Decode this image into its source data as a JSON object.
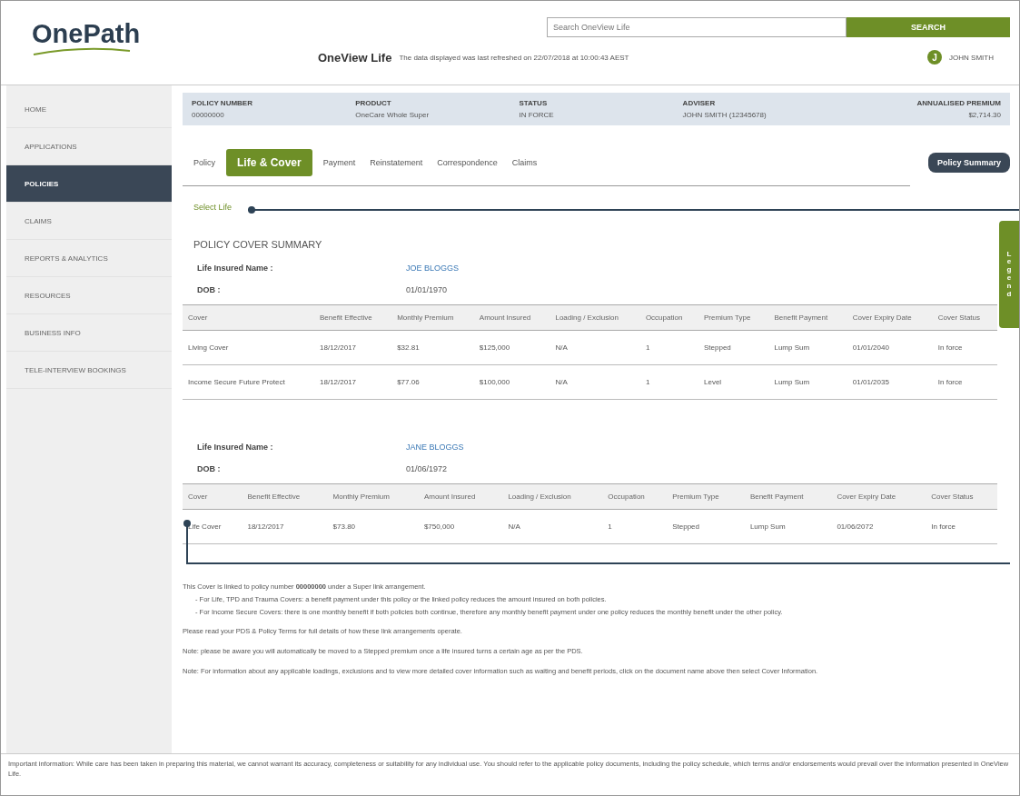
{
  "header": {
    "logo": "OnePath",
    "search": {
      "placeholder": "Search OneView Life"
    },
    "search_button": "SEARCH",
    "app_title": "OneView Life",
    "refresh_note": "The data displayed was last refreshed on 22/07/2018 at 10:00:43 AEST",
    "user": {
      "initial": "J",
      "name": "JOHN SMITH"
    }
  },
  "sidebar": {
    "items": [
      {
        "label": "HOME",
        "selected": false
      },
      {
        "label": "APPLICATIONS",
        "selected": false
      },
      {
        "label": "POLICIES",
        "selected": true
      },
      {
        "label": "CLAIMS",
        "selected": false
      },
      {
        "label": "REPORTS & ANALYTICS",
        "selected": false
      },
      {
        "label": "RESOURCES",
        "selected": false
      },
      {
        "label": "BUSINESS INFO",
        "selected": false
      },
      {
        "label": "TELE-INTERVIEW BOOKINGS",
        "selected": false
      }
    ]
  },
  "policy_header": [
    {
      "label": "POLICY NUMBER",
      "value": "00000000"
    },
    {
      "label": "PRODUCT",
      "value": "OneCare Whole Super"
    },
    {
      "label": "STATUS",
      "value": "IN FORCE"
    },
    {
      "label": "ADVISER",
      "value": "JOHN SMITH (12345678)"
    },
    {
      "label": "ANNUALISED PREMIUM",
      "value": "$2,714.30"
    }
  ],
  "tabs": [
    {
      "label": "Policy",
      "selected": false
    },
    {
      "label": "Life & Cover",
      "selected": true
    },
    {
      "label": "Payment",
      "selected": false
    },
    {
      "label": "Reinstatement",
      "selected": false
    },
    {
      "label": "Correspondence",
      "selected": false
    },
    {
      "label": "Claims",
      "selected": false
    }
  ],
  "summary_button": "Policy Summary",
  "legend_tab": "Legend",
  "select_link": "Select Life",
  "section_title": "POLICY COVER SUMMARY",
  "lives": [
    {
      "name_label": "Life Insured Name :",
      "name": "JOE BLOGGS",
      "dob_label": "DOB :",
      "dob": "01/01/1970",
      "columns": [
        "Cover",
        "Benefit Effective",
        "Monthly Premium",
        "Amount Insured",
        "Loading / Exclusion",
        "Occupation",
        "Premium Type",
        "Benefit Payment",
        "Cover Expiry Date",
        "Cover Status"
      ],
      "rows": [
        [
          "Living Cover",
          "18/12/2017",
          "$32.81",
          "$125,000",
          "N/A",
          "1",
          "Stepped",
          "Lump Sum",
          "01/01/2040",
          "In force"
        ],
        [
          "Income Secure Future Protect",
          "18/12/2017",
          "$77.06",
          "$100,000",
          "N/A",
          "1",
          "Level",
          "Lump Sum",
          "01/01/2035",
          "In force"
        ]
      ]
    },
    {
      "name_label": "Life Insured Name :",
      "name": "JANE BLOGGS",
      "dob_label": "DOB :",
      "dob": "01/06/1972",
      "columns": [
        "Cover",
        "Benefit Effective",
        "Monthly Premium",
        "Amount Insured",
        "Loading / Exclusion",
        "Occupation",
        "Premium Type",
        "Benefit Payment",
        "Cover Expiry Date",
        "Cover Status"
      ],
      "rows": [
        [
          "Life Cover",
          "18/12/2017",
          "$73.80",
          "$750,000",
          "N/A",
          "1",
          "Stepped",
          "Lump Sum",
          "01/06/2072",
          "In force"
        ]
      ]
    }
  ],
  "notes": [
    {
      "text": "This Cover is linked to policy number **00000000** under a Super link arrangement."
    },
    {
      "text": "- For Life, TPD and Trauma Covers: a benefit payment under this policy or the linked policy reduces the amount insured on both policies.",
      "kind": "bullet"
    },
    {
      "text": "- For Income Secure Covers: there is one monthly benefit if both policies both continue, therefore any monthly benefit payment under one policy reduces the monthly benefit under the other policy.",
      "kind": "bullet"
    },
    {
      "text": "Please read your PDS & Policy Terms for full details of how these link arrangements operate."
    },
    {
      "text": "Note: please be aware you will automatically be moved to a Stepped premium once a life insured turns a certain age as per the PDS."
    },
    {
      "text": "Note: For information about any applicable loadings, exclusions and to view more detailed cover information such as waiting and benefit periods, click on the document name above then select Cover Information."
    }
  ],
  "footer": "Important information: While care has been taken in preparing this material, we cannot warrant its accuracy, completeness or suitability for any individual use. You should refer to the applicable policy documents, including the policy schedule, which terms and/or endorsements would prevail over the information presented in OneView Life."
}
